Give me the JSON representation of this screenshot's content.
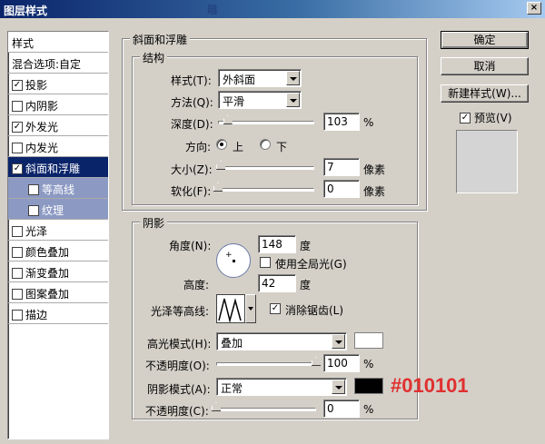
{
  "window": {
    "title": "图层样式",
    "title_ghost": "雕",
    "close_glyph": "×"
  },
  "style_list": {
    "header": "样式",
    "blend_options": "混合选项:自定",
    "items": [
      {
        "label": "投影",
        "checked": true
      },
      {
        "label": "内阴影",
        "checked": false
      },
      {
        "label": "外发光",
        "checked": true
      },
      {
        "label": "内发光",
        "checked": false
      },
      {
        "label": "斜面和浮雕",
        "checked": true,
        "selected": true
      },
      {
        "label": "等高线",
        "checked": false,
        "sub": true
      },
      {
        "label": "纹理",
        "checked": false,
        "sub": true
      },
      {
        "label": "光泽",
        "checked": false
      },
      {
        "label": "颜色叠加",
        "checked": false
      },
      {
        "label": "渐变叠加",
        "checked": false
      },
      {
        "label": "图案叠加",
        "checked": false
      },
      {
        "label": "描边",
        "checked": false
      }
    ]
  },
  "buttons": {
    "ok": "确定",
    "cancel": "取消",
    "new_style": "新建样式(W)...",
    "preview_label": "预览(V)",
    "preview_checked": true
  },
  "bevel": {
    "section_title": "斜面和浮雕",
    "structure_title": "结构",
    "style_label": "样式(T):",
    "style_value": "外斜面",
    "technique_label": "方法(Q):",
    "technique_value": "平滑",
    "depth_label": "深度(D):",
    "depth_value": "103",
    "depth_unit": "%",
    "depth_slider": 0.1,
    "direction_label": "方向:",
    "direction_up": "上",
    "direction_down": "下",
    "direction_selected": "up",
    "size_label": "大小(Z):",
    "size_value": "7",
    "size_unit": "像素",
    "size_slider": 0.03,
    "soften_label": "软化(F):",
    "soften_value": "0",
    "soften_unit": "像素",
    "soften_slider": 0.0
  },
  "shading": {
    "title": "阴影",
    "angle_label": "角度(N):",
    "angle_value": "148",
    "angle_unit": "度",
    "global_light_label": "使用全局光(G)",
    "global_light_checked": false,
    "altitude_label": "高度:",
    "altitude_value": "42",
    "altitude_unit": "度",
    "gloss_contour_label": "光泽等高线:",
    "anti_alias_label": "消除锯齿(L)",
    "anti_alias_checked": true,
    "highlight_mode_label": "高光模式(H):",
    "highlight_mode_value": "叠加",
    "highlight_color": "#ffffff",
    "highlight_opacity_label": "不透明度(O):",
    "highlight_opacity_value": "100",
    "highlight_opacity_unit": "%",
    "highlight_opacity_slider": 1.0,
    "shadow_mode_label": "阴影模式(A):",
    "shadow_mode_value": "正常",
    "shadow_color": "#010101",
    "shadow_opacity_label": "不透明度(C):",
    "shadow_opacity_value": "0",
    "shadow_opacity_unit": "%",
    "shadow_opacity_slider": 0.0
  },
  "annotation": {
    "text": "#010101",
    "color": "#e03030"
  }
}
